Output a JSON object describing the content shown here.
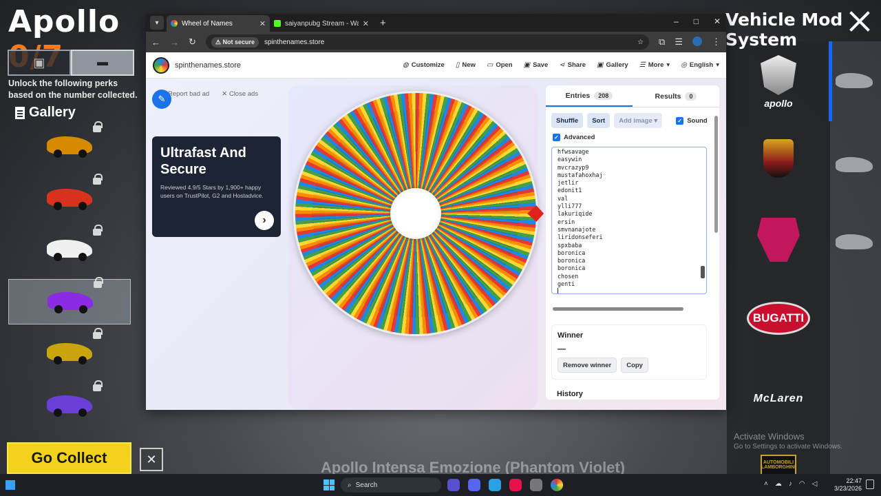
{
  "game": {
    "title_name": "Apollo",
    "title_count": "0/7",
    "unlock_text": "Unlock the following perks based on the number collected.",
    "gallery_label": "Gallery",
    "go_collect_label": "Go Collect",
    "bottom_caption": "Apollo Intensa Emozione (Phantom Violet)",
    "vehicle_system_title": "Vehicle Mod System",
    "brands": [
      "apollo",
      "BUGATTI",
      "McLaren",
      "AUTOMOBILI LAMBORGHINI"
    ],
    "car_colors": [
      "#d68a00",
      "#d8321f",
      "#f0f0f0",
      "#8a2be2",
      "#c9a40a",
      "#6a3fd8"
    ],
    "activate_windows": "Activate Windows",
    "activate_windows_sub": "Go to Settings to activate Windows."
  },
  "browser": {
    "tabs": [
      {
        "title": "Wheel of Names",
        "active": true
      },
      {
        "title": "saiyanpubg Stream - Watch Live",
        "active": false
      }
    ],
    "security_label": "Not secure",
    "url": "spinthenames.store",
    "win_controls": [
      "–",
      "□",
      "✕"
    ]
  },
  "site": {
    "name": "spinthenames.store",
    "menu": [
      {
        "label": "Customize",
        "icon": "palette-icon"
      },
      {
        "label": "New",
        "icon": "file-icon"
      },
      {
        "label": "Open",
        "icon": "folder-icon"
      },
      {
        "label": "Save",
        "icon": "save-icon"
      },
      {
        "label": "Share",
        "icon": "share-icon"
      },
      {
        "label": "Gallery",
        "icon": "gallery-icon"
      },
      {
        "label": "More",
        "icon": "menu-icon"
      },
      {
        "label": "English",
        "icon": "globe-icon"
      }
    ],
    "report_bad_ad": "Report bad ad",
    "close_ads": "Close ads",
    "ad": {
      "title": "Ultrafast And Secure",
      "subtitle": "Reviewed 4.9/5 Stars by 1,900+ happy users on TrustPilot, G2 and Hostadvice."
    },
    "panel": {
      "entries_label": "Entries",
      "entries_count": "208",
      "results_label": "Results",
      "results_count": "0",
      "shuffle": "Shuffle",
      "sort": "Sort",
      "add_image": "Add image",
      "sound": "Sound",
      "advanced": "Advanced",
      "entries": [
        "hfwsavage",
        "easywin",
        "mvcrazyp9",
        "mustafahoxhaj",
        "jetlir",
        "edonit1",
        "val",
        "ylli777",
        "lakuriqide",
        "ersin",
        "smvnanajote",
        "liridonseferi",
        "spxbaba",
        "boronica",
        "boronica",
        "boronica",
        "chosen",
        "genti"
      ],
      "winner_title": "Winner",
      "winner_value": "—",
      "remove_winner": "Remove winner",
      "copy": "Copy",
      "history_label": "History"
    }
  },
  "taskbar": {
    "search_placeholder": "Search",
    "time": "22:47",
    "date": "3/23/2026"
  }
}
